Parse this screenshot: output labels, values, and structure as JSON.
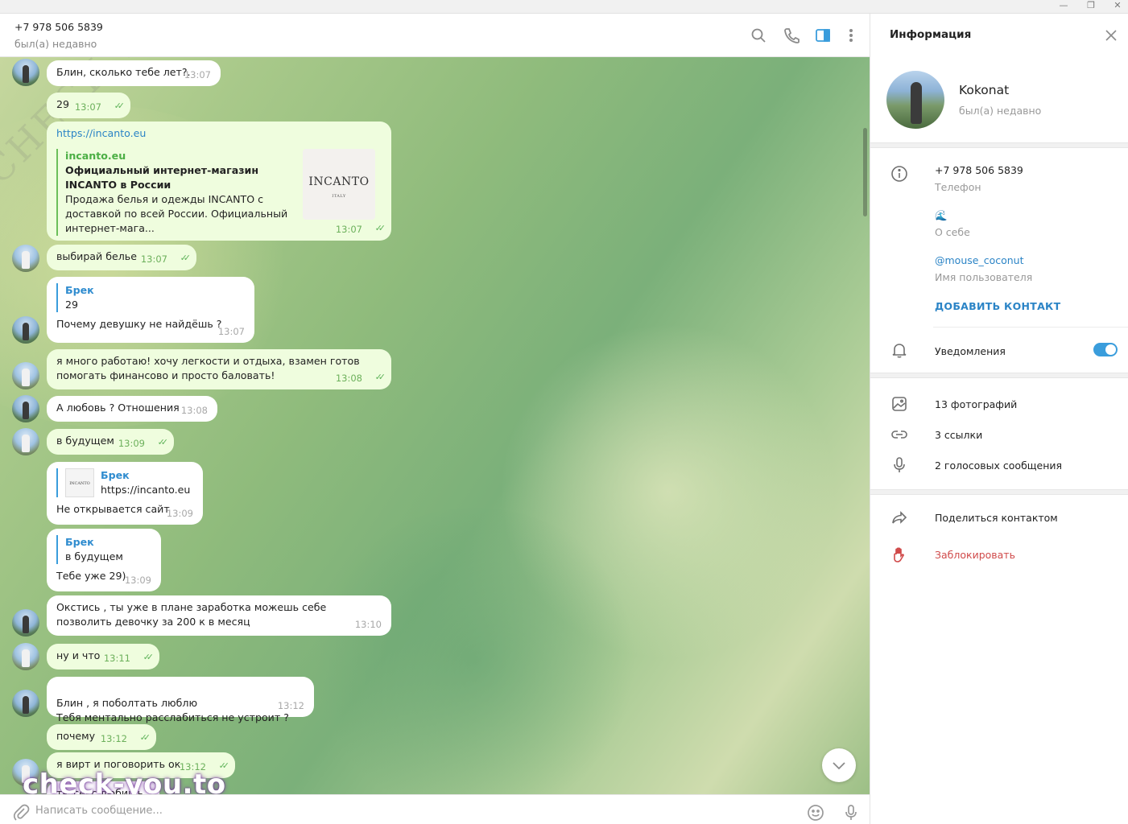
{
  "window": {
    "minimize": "—",
    "restore": "❐",
    "close": "✕"
  },
  "header": {
    "title": "+7 978 506 5839",
    "status": "был(а) недавно"
  },
  "messages": [
    {
      "text": "Блин, сколько тебе лет?.",
      "time": "13:07",
      "dir": "in"
    },
    {
      "text": "29",
      "time": "13:07",
      "dir": "out"
    },
    {
      "url": "https://incanto.eu",
      "site": "incanto.eu",
      "title": "Официальный интернет-магазин INCANTO в России",
      "desc": "Продажа белья и одежды INCANTO с доставкой по всей России. Официальный интернет-мага...",
      "thumb": "INCANTO",
      "thumb_sub": "ITALY",
      "time": "13:07",
      "dir": "out"
    },
    {
      "text": "выбирай белье",
      "time": "13:07",
      "dir": "out"
    },
    {
      "reply_name": "Брек",
      "reply_text": "29",
      "text": "Почему девушку не найдёшь ?",
      "time": "13:07",
      "dir": "in"
    },
    {
      "text": "я  много работаю! хочу легкости и отдыха, взамен готов помогать финансово и просто баловать!",
      "time": "13:08",
      "dir": "out"
    },
    {
      "text": "А любовь ? Отношения",
      "time": "13:08",
      "dir": "in"
    },
    {
      "text": "в будущем",
      "time": "13:09",
      "dir": "out"
    },
    {
      "reply_name": "Брек",
      "reply_text": "https://incanto.eu",
      "reply_thumb": "INCANTO",
      "text": "Не открывается сайт",
      "time": "13:09",
      "dir": "in"
    },
    {
      "reply_name": "Брек",
      "reply_text": "в будущем",
      "text": "Тебе уже 29)",
      "time": "13:09",
      "dir": "in"
    },
    {
      "text": "Окстись , ты уже в плане заработка можешь себе позволить девочку за 200 к в месяц",
      "time": "13:10",
      "dir": "in"
    },
    {
      "text": "ну и что",
      "time": "13:11",
      "dir": "out"
    },
    {
      "text": "Блин , я поболтать люблю\nТебя ментально расслабиться не устроит ?",
      "time": "13:12",
      "dir": "in"
    },
    {
      "text": "почему",
      "time": "13:12",
      "dir": "out"
    },
    {
      "text": "я вирт и поговорить ок",
      "time": "13:12",
      "dir": "out"
    },
    {
      "text": "ты секс любишь ?",
      "dir": "in"
    }
  ],
  "compose": {
    "placeholder": "Написать сообщение..."
  },
  "watermark": {
    "text": "check-you.to",
    "diag": "CHECK YOU ME"
  },
  "panel": {
    "title": "Информация",
    "name": "Kokonat",
    "status": "был(а) недавно",
    "phone": "+7 978 506 5839",
    "phone_label": "Телефон",
    "bio": "🌊",
    "bio_label": "О себе",
    "username": "@mouse_coconut",
    "username_label": "Имя пользователя",
    "add_contact": "ДОБАВИТЬ КОНТАКТ",
    "notifications": "Уведомления",
    "notifications_on": true,
    "photos": "13 фотографий",
    "links": "3 ссылки",
    "voice": "2 голосовых сообщения",
    "share": "Поделиться контактом",
    "block": "Заблокировать"
  },
  "colors": {
    "accent": "#3a9ddc",
    "out_bubble": "#effdde",
    "in_bubble": "#ffffff",
    "check": "#5fb35a",
    "danger": "#d04a4a"
  }
}
